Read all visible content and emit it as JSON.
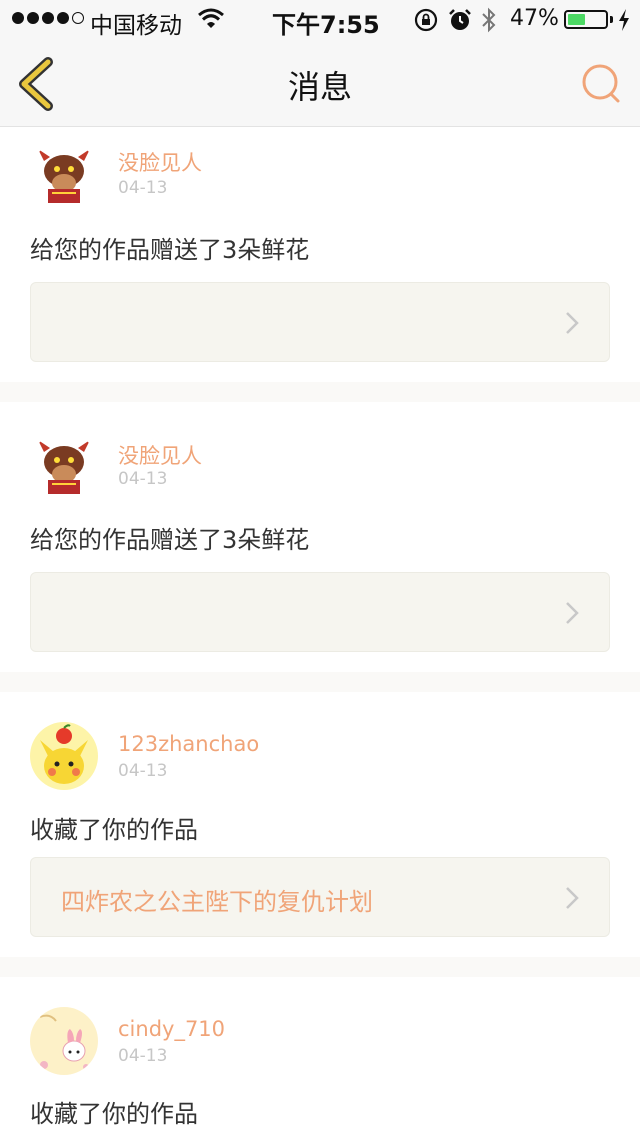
{
  "status_bar": {
    "carrier": "中国移动",
    "time": "下午7:55",
    "battery_percent": "47%",
    "battery_level": 0.47,
    "signal_bars": 4,
    "signal_total": 5
  },
  "nav": {
    "title": "消息",
    "back_icon": "chevron-left-icon",
    "search_icon": "search-icon"
  },
  "colors": {
    "accent": "#f0a478",
    "back_icon": "#e9c73e",
    "card_bg": "#ffffff",
    "page_bg": "#faf9f7",
    "work_box_bg": "#f6f5ef"
  },
  "messages": [
    {
      "user": "没脸见人",
      "date": "04-13",
      "text": "给您的作品赠送了3朵鲜花",
      "work_title": "",
      "avatar": "demon-bull-avatar"
    },
    {
      "user": "没脸见人",
      "date": "04-13",
      "text": "给您的作品赠送了3朵鲜花",
      "work_title": "",
      "avatar": "demon-bull-avatar"
    },
    {
      "user": "123zhanchao",
      "date": "04-13",
      "text": "收藏了你的作品",
      "work_title": "四炸农之公主陛下的复仇计划",
      "avatar": "pikachu-avatar"
    },
    {
      "user": "cindy_710",
      "date": "04-13",
      "text": "收藏了你的作品",
      "work_title": "",
      "avatar": "my-melody-avatar"
    }
  ]
}
